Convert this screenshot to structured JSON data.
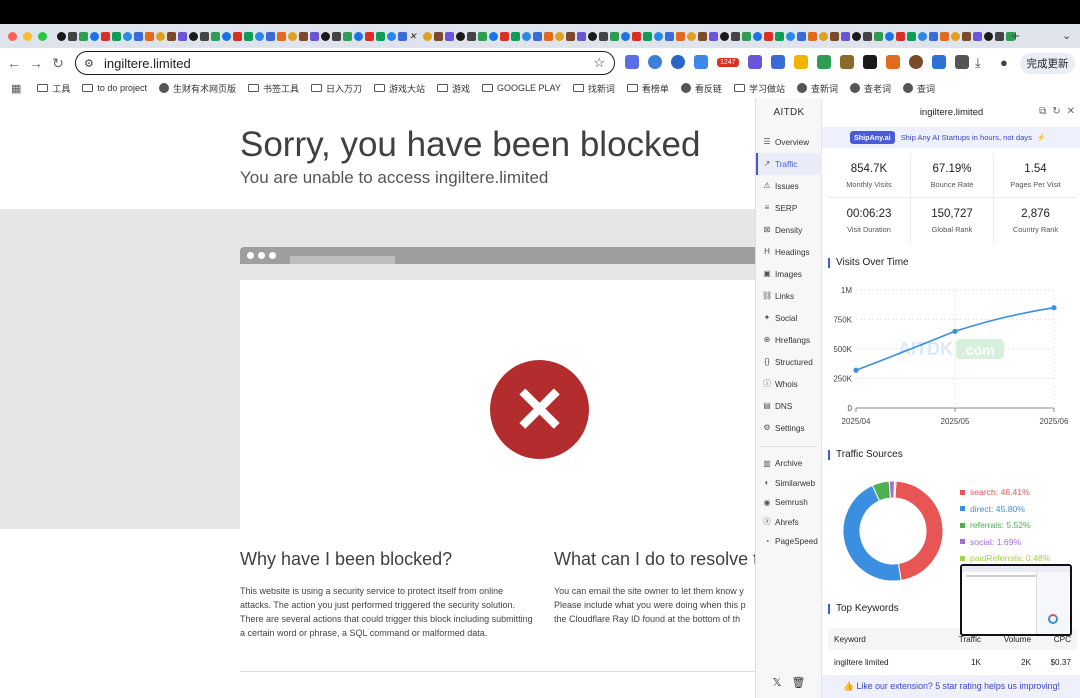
{
  "browser": {
    "url": "ingiltere.limited",
    "ext_badge": "1247",
    "update_button": "完成更新"
  },
  "bookmarks": [
    {
      "label": "工具",
      "type": "folder"
    },
    {
      "label": "to do project",
      "type": "folder"
    },
    {
      "label": "生财有术网页版",
      "type": "site"
    },
    {
      "label": "书签工具",
      "type": "folder"
    },
    {
      "label": "日入万刀",
      "type": "folder"
    },
    {
      "label": "游戏大站",
      "type": "folder"
    },
    {
      "label": "游戏",
      "type": "folder"
    },
    {
      "label": "GOOGLE PLAY",
      "type": "folder"
    },
    {
      "label": "找新词",
      "type": "folder"
    },
    {
      "label": "看榜单",
      "type": "folder"
    },
    {
      "label": "看反链",
      "type": "site"
    },
    {
      "label": "学习做站",
      "type": "folder"
    },
    {
      "label": "查新词",
      "type": "site"
    },
    {
      "label": "查老词",
      "type": "site"
    },
    {
      "label": "查词",
      "type": "site"
    }
  ],
  "page": {
    "title": "Sorry, you have been blocked",
    "subtitle": "You are unable to access ingiltere.limited",
    "why_heading": "Why have I been blocked?",
    "why_text": "This website is using a security service to protect itself from online attacks. The action you just performed triggered the security solution. There are several actions that could trigger this block including submitting a certain word or phrase, a SQL command or malformed data.",
    "what_heading": "What can I do to resolve t",
    "what_lines": [
      "You can email the site owner to let them know y",
      "Please include what you were doing when this p",
      "the Cloudflare Ray ID found at the bottom of th"
    ]
  },
  "panel": {
    "logo": "AITDK",
    "domain": "ingiltere.limited",
    "nav": [
      "Overview",
      "Traffic",
      "Issues",
      "SERP",
      "Density",
      "Headings",
      "Images",
      "Links",
      "Social",
      "Hreflangs",
      "Structured",
      "Whois",
      "DNS",
      "Settings"
    ],
    "nav_active": "Traffic",
    "tools": [
      "Archive",
      "Similarweb",
      "Semrush",
      "Ahrefs",
      "PageSpeed"
    ],
    "banner_tag": "ShipAny.ai",
    "banner_text": "Ship Any AI Startups in hours, not days",
    "stats": [
      {
        "value": "854.7K",
        "label": "Monthly Visits"
      },
      {
        "value": "67.19%",
        "label": "Bounce Rate"
      },
      {
        "value": "1.54",
        "label": "Pages Per Visit"
      },
      {
        "value": "00:06:23",
        "label": "Visit Duration"
      },
      {
        "value": "150,727",
        "label": "Global Rank"
      },
      {
        "value": "2,876",
        "label": "Country Rank"
      }
    ],
    "visits_title": "Visits Over Time",
    "sources_title": "Traffic Sources",
    "keywords_title": "Top Keywords",
    "watermark_a": "AITDK",
    "watermark_b": ".com",
    "kw_headers": [
      "Keyword",
      "Traffic",
      "Volume",
      "CPC"
    ],
    "kw_rows": [
      {
        "keyword": "ingiltere limited",
        "traffic": "1K",
        "volume": "2K",
        "cpc": "$0.37"
      }
    ],
    "footer": "👍 Like our extension? 5 star rating helps us improving!"
  },
  "chart_data": [
    {
      "type": "line",
      "title": "Visits Over Time",
      "x": [
        "2025/04",
        "2025/05",
        "2025/06"
      ],
      "series": [
        {
          "values": [
            320000,
            650000,
            850000
          ]
        }
      ],
      "yticks": [
        "0",
        "250K",
        "500K",
        "750K",
        "1M"
      ],
      "ylim": [
        0,
        1000000
      ],
      "grid": true,
      "color": "#3b8fe0"
    },
    {
      "type": "pie",
      "title": "Traffic Sources",
      "slices": [
        {
          "label": "search",
          "value": 46.41,
          "text": "search: 46.41%",
          "color": "#e85555"
        },
        {
          "label": "direct",
          "value": 45.8,
          "text": "direct: 45.80%",
          "color": "#3b8fe0"
        },
        {
          "label": "referrals",
          "value": 5.52,
          "text": "referrals: 5.52%",
          "color": "#4caf50"
        },
        {
          "label": "social",
          "value": 1.69,
          "text": "social: 1.69%",
          "color": "#a56bd8"
        },
        {
          "label": "paidReferrals",
          "value": 0.48,
          "text": "paidReferrals: 0.48%",
          "color": "#a3d24a"
        }
      ]
    }
  ]
}
